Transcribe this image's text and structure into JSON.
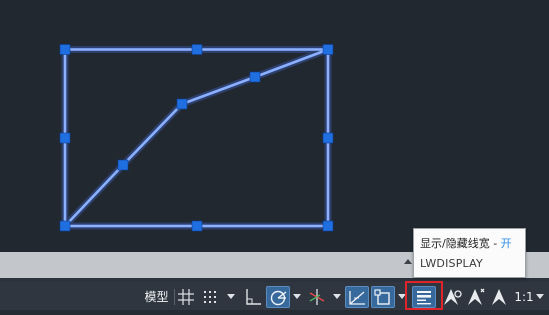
{
  "status_bar": {
    "model_tab_label": "模型",
    "scale_label": "1:1",
    "buttons": [
      {
        "icon": "grid-icon",
        "active": false
      },
      {
        "icon": "snap-dots-icon",
        "active": false
      },
      {
        "icon": "ortho-icon",
        "active": false
      },
      {
        "icon": "polar-tracking-icon",
        "active": true
      },
      {
        "icon": "isometric-drafting-icon",
        "active": false
      },
      {
        "icon": "object-snap-tracking-icon",
        "active": true
      },
      {
        "icon": "object-snap-icon",
        "active": true
      },
      {
        "icon": "show-hide-lineweight-icon",
        "active": true
      },
      {
        "icon": "annotation-visibility-icon",
        "active": false
      },
      {
        "icon": "auto-scale-icon",
        "active": false
      },
      {
        "icon": "annotation-scale-icon",
        "active": false
      }
    ]
  },
  "tooltip": {
    "title": "显示/隐藏线宽 - ",
    "state": "开",
    "command": "LWDISPLAY"
  },
  "colors": {
    "canvas_background": "#212830",
    "geometry_line": "#7fa7ff",
    "grip": "#1f6fe0",
    "status_bar": "#2f363f",
    "active_button": "#38699d",
    "highlight_box": "#e0242b",
    "tooltip_state": "#2f8ee3"
  }
}
